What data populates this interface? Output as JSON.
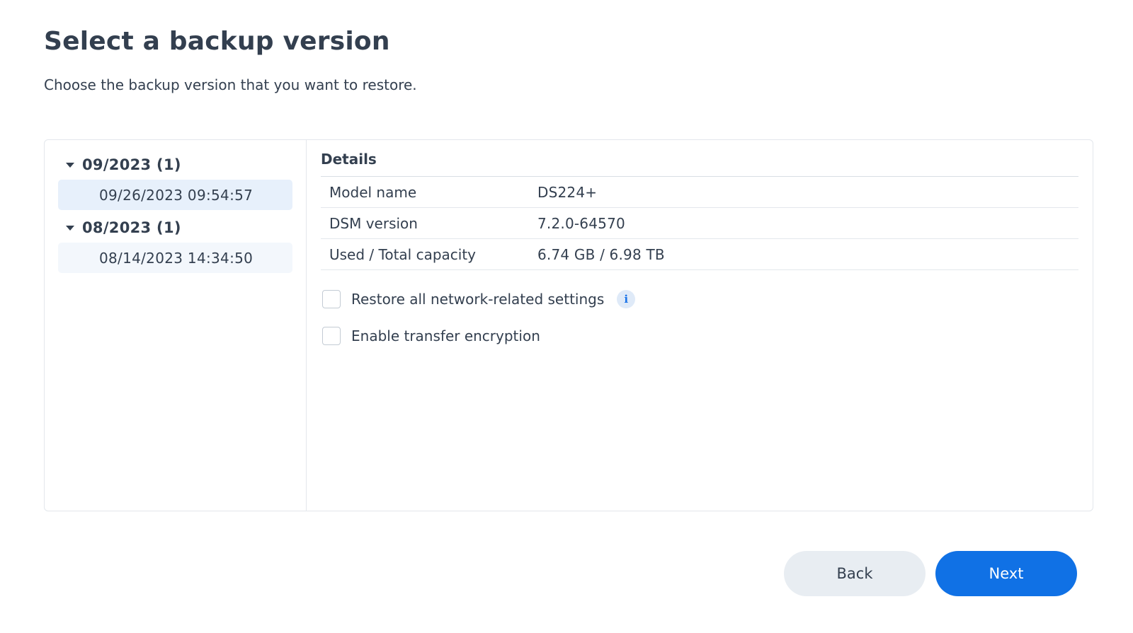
{
  "header": {
    "title": "Select a backup version",
    "subtitle": "Choose the backup version that you want to restore."
  },
  "tree": {
    "groups": [
      {
        "label": "09/2023 (1)",
        "expanded": true,
        "items": [
          {
            "label": "09/26/2023 09:54:57",
            "selected": true
          }
        ]
      },
      {
        "label": "08/2023 (1)",
        "expanded": true,
        "items": [
          {
            "label": "08/14/2023 14:34:50",
            "selected": false
          }
        ]
      }
    ]
  },
  "details": {
    "title": "Details",
    "rows": [
      {
        "key": "Model name",
        "value": "DS224+"
      },
      {
        "key": "DSM version",
        "value": "7.2.0-64570"
      },
      {
        "key": "Used / Total capacity",
        "value": "6.74 GB / 6.98 TB"
      }
    ],
    "options": [
      {
        "label": "Restore all network-related settings",
        "checked": false,
        "has_info": true
      },
      {
        "label": "Enable transfer encryption",
        "checked": false,
        "has_info": false
      }
    ],
    "info_icon_glyph": "i"
  },
  "footer": {
    "back_label": "Back",
    "next_label": "Next"
  },
  "colors": {
    "accent": "#1071e5",
    "selected_item_bg": "#e7f0fb",
    "secondary_button_bg": "#e8edf2"
  },
  "icons": {
    "caret": "caret-down-icon",
    "info": "info-icon"
  }
}
